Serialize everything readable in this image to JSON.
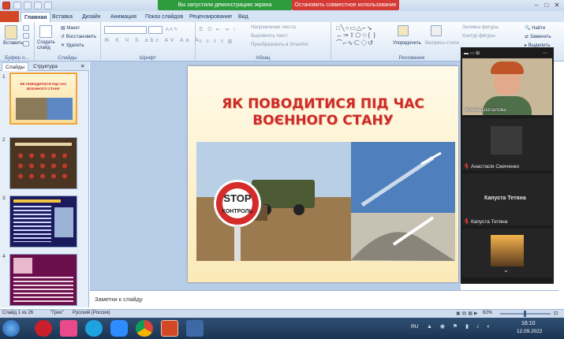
{
  "app": {
    "share_status": "Вы запустили демонстрацию экрана",
    "stop_share": "Остановить совместное использование"
  },
  "tabs": [
    "Главная",
    "Вставка",
    "Дизайн",
    "Анимация",
    "Показ слайдов",
    "Рецензирование",
    "Вид"
  ],
  "ribbon": {
    "paste": "Вставить",
    "clipboard_label": "Буфер о...",
    "new_slide": "Создать слайд",
    "layout": "Макет",
    "restore": "Восстановить",
    "delete": "Удалить",
    "slides_label": "Слайды",
    "font_label": "Шрифт",
    "paragraph_label": "Абзац",
    "text_direction": "Направление текста",
    "align_text": "Выровнять текст",
    "smartart": "Преобразовать в SmartArt",
    "arrange": "Упорядочить",
    "quick_styles": "Экспресс-стили",
    "shape_fill": "Заливка фигуры",
    "shape_outline": "Контур фигуры",
    "shape_effects": "Эффекты фигуры",
    "drawing_label": "Рисование",
    "find": "Найти",
    "replace": "Заменить",
    "select": "Выделить"
  },
  "panel_tabs": [
    "Слайды",
    "Структура"
  ],
  "thumbnails": [
    {
      "num": "1",
      "title": "ЯК ПОВОДИТИСЯ ПІД ЧАС ВОЄННОГО СТАНУ"
    },
    {
      "num": "2"
    },
    {
      "num": "3"
    },
    {
      "num": "4"
    }
  ],
  "slide": {
    "title": "ЯК ПОВОДИТИСЯ ПІД ЧАС\nВОЄННОГО СТАНУ",
    "stop_sign": "STOP",
    "stop_sub": "КОНТРОЛЬ"
  },
  "notes_placeholder": "Заметки к слайду",
  "status": {
    "slide_of": "Слайд 1 из 26",
    "theme": "\"Грех\"",
    "language": "Русский (Россия)",
    "zoom": "62%"
  },
  "participants": [
    {
      "name": "Жанна Шаталова",
      "video": "person"
    },
    {
      "name": "Анастасія Смиченко",
      "video": "dark"
    },
    {
      "name": "Капуста Тетяна",
      "video": "text",
      "display": "Капуста Тетяна"
    },
    {
      "name": "",
      "video": "sunset"
    }
  ],
  "tray": {
    "lang": "RU",
    "time": "16:10",
    "date": "12.09.2022"
  },
  "colors": {
    "accent": "#2b579a",
    "title_red": "#cc2b2b",
    "share_green": "#2e9c3c",
    "stop_red": "#d63a34"
  }
}
